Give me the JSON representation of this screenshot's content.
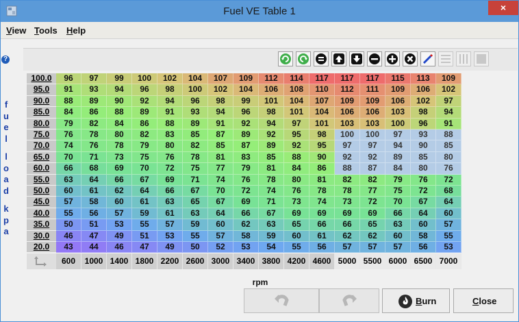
{
  "window": {
    "title": "Fuel VE Table 1",
    "close_glyph": "×"
  },
  "menu": [
    {
      "label": "View",
      "mnemonic": "V",
      "rest": "iew"
    },
    {
      "label": "Tools",
      "mnemonic": "T",
      "rest": "ools"
    },
    {
      "label": "Help",
      "mnemonic": "H",
      "rest": "elp"
    }
  ],
  "help_glyph": "?",
  "toolbar": {
    "buttons": [
      {
        "name": "undo-green-icon",
        "enabled": true
      },
      {
        "name": "redo-green-icon",
        "enabled": true
      },
      {
        "name": "equals-icon",
        "enabled": true
      },
      {
        "name": "increase-icon",
        "enabled": true
      },
      {
        "name": "decrease-icon",
        "enabled": true
      },
      {
        "name": "minus-icon",
        "enabled": true
      },
      {
        "name": "plus-icon",
        "enabled": true
      },
      {
        "name": "multiply-icon",
        "enabled": true
      },
      {
        "name": "pencil-icon",
        "enabled": true
      },
      {
        "name": "horizontal-lines-icon",
        "enabled": false
      },
      {
        "name": "vertical-lines-icon",
        "enabled": false
      },
      {
        "name": "solid-block-icon",
        "enabled": false
      }
    ]
  },
  "table": {
    "y_axis_label": "fuel load kpa",
    "x_axis_label": "rpm",
    "y_ticks": [
      "100.0",
      "95.0",
      "90.0",
      "85.0",
      "80.0",
      "75.0",
      "70.0",
      "65.0",
      "60.0",
      "55.0",
      "50.0",
      "45.0",
      "40.0",
      "35.0",
      "30.0",
      "20.0"
    ],
    "x_ticks": [
      "600",
      "1000",
      "1400",
      "1800",
      "2200",
      "2600",
      "3000",
      "3400",
      "3800",
      "4200",
      "4600",
      "5000",
      "5500",
      "6000",
      "6500",
      "7000"
    ],
    "selected_region": {
      "rows": "75.0–60.0",
      "columns": "5000–7000"
    },
    "rows": [
      [
        "96",
        "97",
        "99",
        "100",
        "102",
        "104",
        "107",
        "109",
        "112",
        "114",
        "117",
        "117",
        "117",
        "115",
        "113",
        "109"
      ],
      [
        "91",
        "93",
        "94",
        "96",
        "98",
        "100",
        "102",
        "104",
        "106",
        "108",
        "110",
        "112",
        "111",
        "109",
        "106",
        "102"
      ],
      [
        "88",
        "89",
        "90",
        "92",
        "94",
        "96",
        "98",
        "99",
        "101",
        "104",
        "107",
        "109",
        "109",
        "106",
        "102",
        "97"
      ],
      [
        "84",
        "86",
        "88",
        "89",
        "91",
        "93",
        "94",
        "96",
        "98",
        "101",
        "104",
        "106",
        "106",
        "103",
        "98",
        "94"
      ],
      [
        "79",
        "82",
        "84",
        "86",
        "88",
        "89",
        "91",
        "92",
        "94",
        "97",
        "101",
        "103",
        "103",
        "100",
        "96",
        "91"
      ],
      [
        "76",
        "78",
        "80",
        "82",
        "83",
        "85",
        "87",
        "89",
        "92",
        "95",
        "98",
        "100",
        "100",
        "97",
        "93",
        "88"
      ],
      [
        "74",
        "76",
        "78",
        "79",
        "80",
        "82",
        "85",
        "87",
        "89",
        "92",
        "95",
        "97",
        "97",
        "94",
        "90",
        "85"
      ],
      [
        "70",
        "71",
        "73",
        "75",
        "76",
        "78",
        "81",
        "83",
        "85",
        "88",
        "90",
        "92",
        "92",
        "89",
        "85",
        "80"
      ],
      [
        "66",
        "68",
        "69",
        "70",
        "72",
        "75",
        "77",
        "79",
        "81",
        "84",
        "86",
        "88",
        "87",
        "84",
        "80",
        "76"
      ],
      [
        "63",
        "64",
        "66",
        "67",
        "69",
        "71",
        "74",
        "76",
        "78",
        "80",
        "81",
        "82",
        "82",
        "79",
        "76",
        "72"
      ],
      [
        "60",
        "61",
        "62",
        "64",
        "66",
        "67",
        "70",
        "72",
        "74",
        "76",
        "78",
        "78",
        "77",
        "75",
        "72",
        "68"
      ],
      [
        "57",
        "58",
        "60",
        "61",
        "63",
        "65",
        "67",
        "69",
        "71",
        "73",
        "74",
        "73",
        "72",
        "70",
        "67",
        "64"
      ],
      [
        "55",
        "56",
        "57",
        "59",
        "61",
        "63",
        "64",
        "66",
        "67",
        "69",
        "69",
        "69",
        "69",
        "66",
        "64",
        "60"
      ],
      [
        "50",
        "51",
        "53",
        "55",
        "57",
        "59",
        "60",
        "62",
        "63",
        "65",
        "66",
        "66",
        "65",
        "63",
        "60",
        "57"
      ],
      [
        "46",
        "47",
        "49",
        "51",
        "53",
        "55",
        "57",
        "58",
        "59",
        "60",
        "61",
        "62",
        "62",
        "60",
        "58",
        "55"
      ],
      [
        "43",
        "44",
        "46",
        "47",
        "49",
        "50",
        "52",
        "53",
        "54",
        "55",
        "56",
        "57",
        "57",
        "57",
        "56",
        "53"
      ]
    ]
  },
  "buttons": {
    "burn": {
      "label": "Burn",
      "mnemonic": "B",
      "rest": "urn"
    },
    "close": {
      "label": "Close",
      "mnemonic": "C",
      "rest": "lose"
    }
  },
  "colors": {
    "titlebar": "#5b9ad8",
    "close": "#c7423a",
    "selection": "#b4cce6"
  }
}
